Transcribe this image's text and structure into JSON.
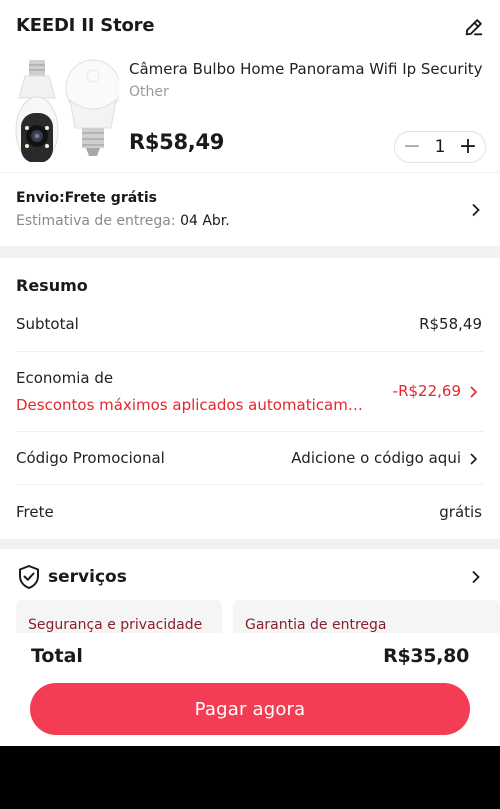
{
  "store": {
    "name": "KEEDI II Store"
  },
  "product": {
    "title": "Câmera Bulbo Home Panorama Wifi Ip Security",
    "variant": "Other",
    "price": "R$58,49",
    "quantity": "1",
    "minus": "−",
    "plus": "+"
  },
  "shipping": {
    "title": "Envio:Frete grátis",
    "estimate_label": "Estimativa de entrega: ",
    "estimate_date": "04 Abr."
  },
  "summary": {
    "title": "Resumo",
    "subtotal_label": "Subtotal",
    "subtotal_value": "R$58,49",
    "savings_label": "Economia de",
    "savings_note": "Descontos máximos aplicados automaticamente",
    "savings_value": "-R$22,69",
    "promo_label": "Código Promocional",
    "promo_value": "Adicione o código aqui",
    "shipping_label": "Frete",
    "shipping_value": "grátis"
  },
  "services": {
    "title": "serviços",
    "cards": [
      "Segurança e privacidade",
      "Garantia de entrega"
    ]
  },
  "footer": {
    "total_label": "Total",
    "total_value": "R$35,80",
    "pay_button": "Pagar agora"
  },
  "colors": {
    "accent": "#f43d54",
    "discount_red": "#e5262c",
    "service_text": "#8b1e2c",
    "muted": "#9a9a9a"
  },
  "icons": [
    "edit-pencil-icon",
    "minus-icon",
    "plus-icon",
    "chevron-right-icon",
    "shield-check-icon"
  ]
}
